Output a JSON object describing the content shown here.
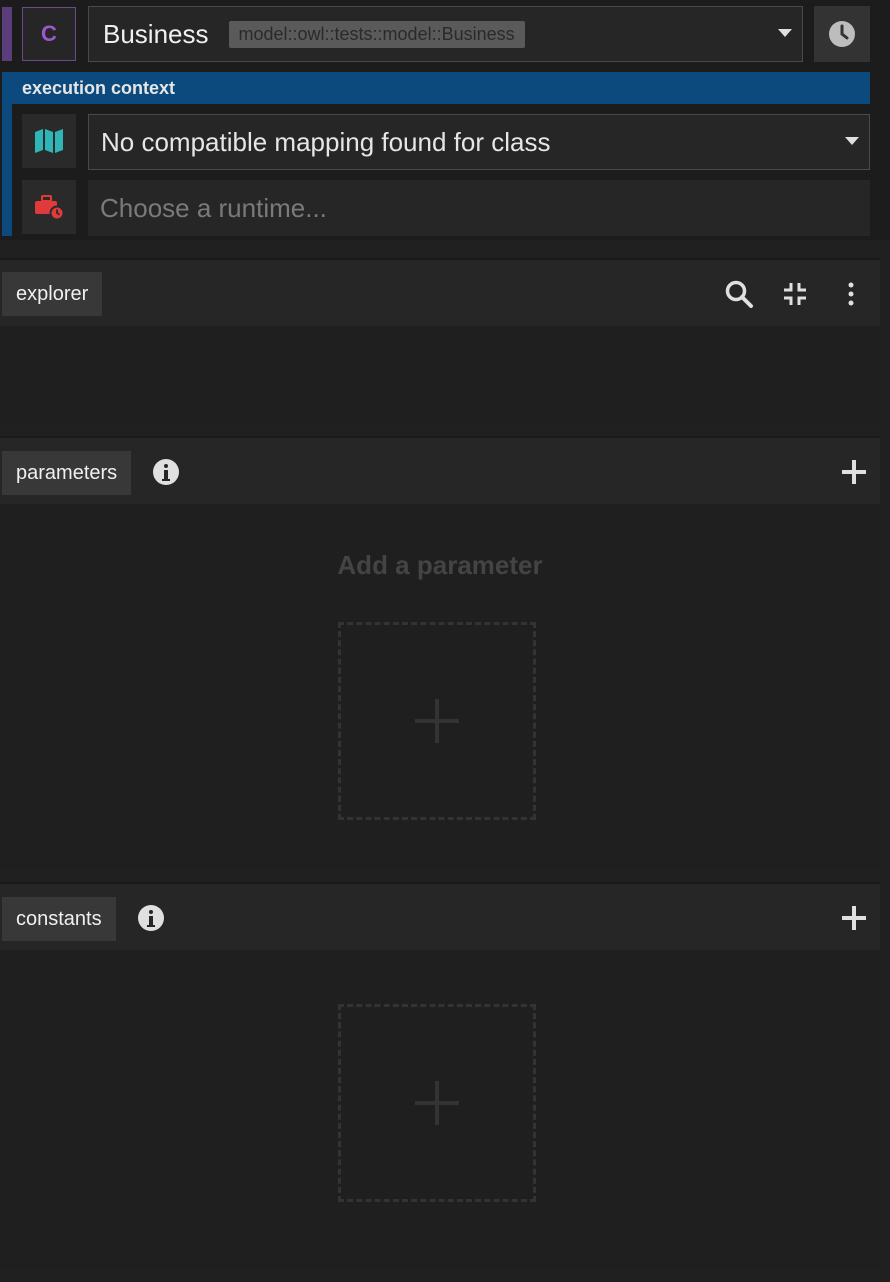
{
  "class_selector": {
    "badge": "C",
    "name": "Business",
    "path": "model::owl::tests::model::Business"
  },
  "execution_context": {
    "title": "execution context",
    "mapping_value": "No compatible mapping found for class",
    "runtime_placeholder": "Choose a runtime..."
  },
  "explorer": {
    "tab_label": "explorer"
  },
  "parameters": {
    "tab_label": "parameters",
    "empty_text": "Add a parameter"
  },
  "constants": {
    "tab_label": "constants"
  },
  "colors": {
    "class_accent": "#9b59d0",
    "context_header": "#0c4a7e",
    "map_icon": "#2fb5b5",
    "runtime_icon": "#e03a3a"
  }
}
